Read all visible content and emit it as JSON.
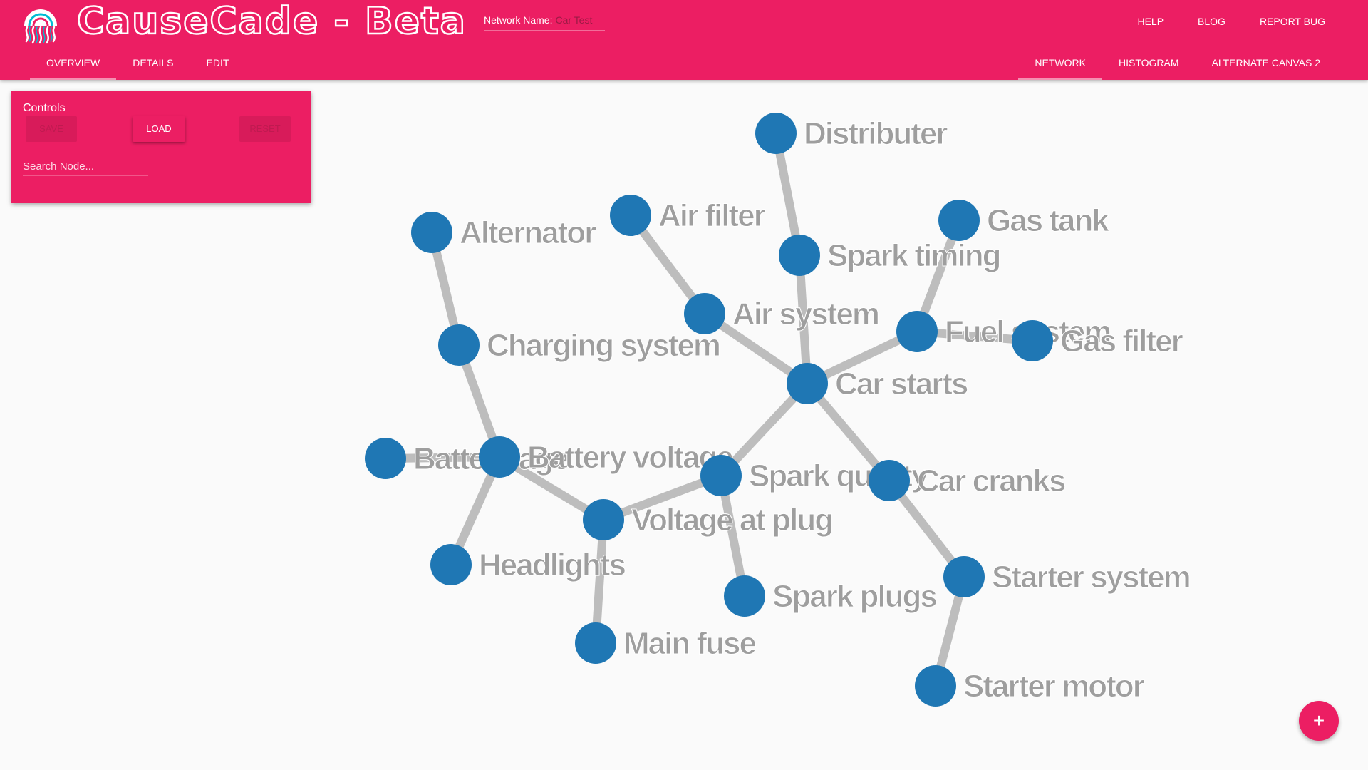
{
  "app": {
    "brand_text": "CauseCade - Beta",
    "network_label": "Network Name:",
    "network_value": "Car Test",
    "accent_color": "#ec1e63"
  },
  "top_links": [
    {
      "label": "HELP"
    },
    {
      "label": "BLOG"
    },
    {
      "label": "REPORT BUG"
    }
  ],
  "tabs_left": [
    {
      "label": "OVERVIEW",
      "active": true
    },
    {
      "label": "DETAILS",
      "active": false
    },
    {
      "label": "EDIT",
      "active": false
    }
  ],
  "tabs_right": [
    {
      "label": "NETWORK",
      "active": true
    },
    {
      "label": "HISTOGRAM",
      "active": false
    },
    {
      "label": "ALTERNATE CANVAS 2",
      "active": false
    }
  ],
  "controls": {
    "title": "Controls",
    "save_label": "SAVE",
    "load_label": "LOAD",
    "reset_label": "RESET",
    "search_placeholder": "Search Node..."
  },
  "fab": {
    "label": "+",
    "icon": "plus-icon"
  },
  "network": {
    "node_color": "#1f77b4",
    "edge_color": "#bdbdbd",
    "label_color": "#9e9e9e",
    "nodes": [
      {
        "id": "distributer",
        "label": "Distributer"
      },
      {
        "id": "airfilter",
        "label": "Air filter"
      },
      {
        "id": "gastank",
        "label": "Gas tank"
      },
      {
        "id": "alternator",
        "label": "Alternator"
      },
      {
        "id": "sparktiming",
        "label": "Spark timing"
      },
      {
        "id": "airsystem",
        "label": "Air system"
      },
      {
        "id": "fuelsystem",
        "label": "Fuel system"
      },
      {
        "id": "gasfilter",
        "label": "Gas filter"
      },
      {
        "id": "charging",
        "label": "Charging system"
      },
      {
        "id": "carstarts",
        "label": "Car starts"
      },
      {
        "id": "battery",
        "label": "Battery age"
      },
      {
        "id": "batteryvoltage",
        "label": "Battery voltage"
      },
      {
        "id": "sparkquality",
        "label": "Spark quality"
      },
      {
        "id": "carcranks",
        "label": "Car cranks"
      },
      {
        "id": "voltageplug",
        "label": "Voltage at plug"
      },
      {
        "id": "headlights",
        "label": "Headlights"
      },
      {
        "id": "sparkplugs",
        "label": "Spark plugs"
      },
      {
        "id": "startersystem",
        "label": "Starter system"
      },
      {
        "id": "mainfuse",
        "label": "Main fuse"
      },
      {
        "id": "startermotor",
        "label": "Starter motor"
      }
    ],
    "edges": [
      [
        "distributer",
        "sparktiming"
      ],
      [
        "sparktiming",
        "carstarts"
      ],
      [
        "airfilter",
        "airsystem"
      ],
      [
        "airsystem",
        "carstarts"
      ],
      [
        "gastank",
        "fuelsystem"
      ],
      [
        "fuelsystem",
        "carstarts"
      ],
      [
        "gasfilter",
        "fuelsystem"
      ],
      [
        "alternator",
        "charging"
      ],
      [
        "charging",
        "batteryvoltage"
      ],
      [
        "battery",
        "batteryvoltage"
      ],
      [
        "batteryvoltage",
        "headlights"
      ],
      [
        "batteryvoltage",
        "voltageplug"
      ],
      [
        "voltageplug",
        "sparkquality"
      ],
      [
        "voltageplug",
        "mainfuse"
      ],
      [
        "sparkquality",
        "carstarts"
      ],
      [
        "sparkquality",
        "sparkplugs"
      ],
      [
        "carcranks",
        "carstarts"
      ],
      [
        "carcranks",
        "startersystem"
      ],
      [
        "startersystem",
        "startermotor"
      ]
    ]
  }
}
